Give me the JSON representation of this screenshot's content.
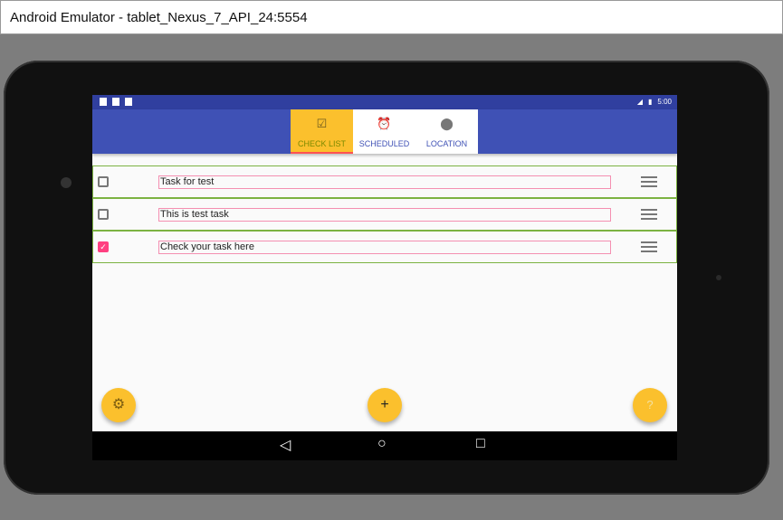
{
  "window": {
    "title": "Android Emulator - tablet_Nexus_7_API_24:5554"
  },
  "status_bar": {
    "time": "5:00"
  },
  "tabs": [
    {
      "label": "CHECK LIST",
      "icon": "checkbox-icon",
      "active": true
    },
    {
      "label": "SCHEDULED",
      "icon": "alarm-icon",
      "active": false
    },
    {
      "label": "LOCATION",
      "icon": "location-pin-icon",
      "active": false
    }
  ],
  "tasks": [
    {
      "text": "Task for test",
      "checked": false
    },
    {
      "text": "This is test task",
      "checked": false
    },
    {
      "text": "Check your task here",
      "checked": true
    }
  ],
  "fabs": {
    "settings": "settings-gear-icon",
    "add": "+",
    "help": "?"
  },
  "colors": {
    "primary": "#3f51b5",
    "primary_dark": "#303f9f",
    "accent": "#fbc02d",
    "checkbox": "#ff4081",
    "row_border": "#7cb342"
  }
}
